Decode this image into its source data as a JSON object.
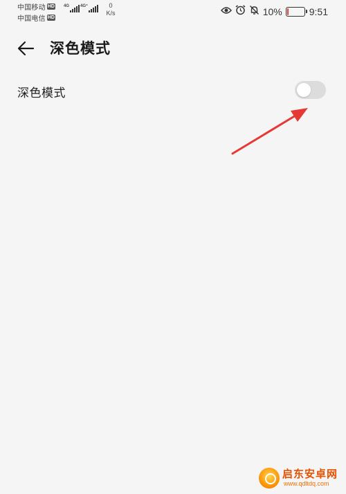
{
  "status_bar": {
    "carrier1": "中国移动",
    "carrier1_badge": "HD",
    "carrier2": "中国电信",
    "carrier2_badge": "HD",
    "net1": "4G",
    "net2": "4G⁺",
    "speed_value": "0",
    "speed_unit": "K/s",
    "icons": [
      "eye-icon",
      "alarm-icon",
      "bell-mute-icon"
    ],
    "battery": "10%",
    "battery_level": 0.1,
    "time": "9:51"
  },
  "header": {
    "title": "深色模式"
  },
  "settings": {
    "dark_mode_label": "深色模式",
    "dark_mode_enabled": false
  },
  "colors": {
    "background": "#f5f5f5",
    "toggle_off": "#dcdcdc",
    "arrow": "#e53935",
    "battery_low": "#e53935"
  },
  "watermark": {
    "title": "启东安卓网",
    "url": "www.qdltdq.com"
  }
}
